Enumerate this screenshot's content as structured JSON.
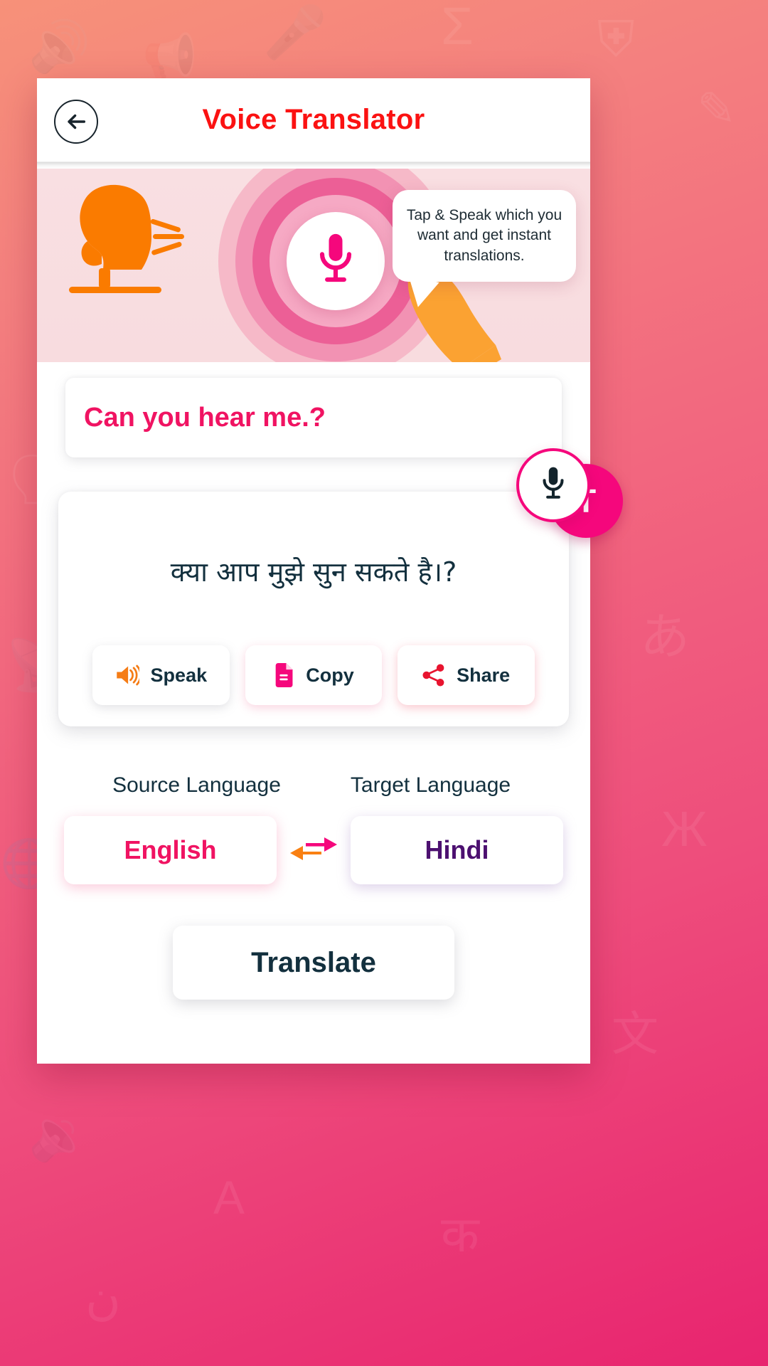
{
  "header": {
    "title": "Voice Translator",
    "back_icon": "arrow-left-icon",
    "title_color": "#fb1212"
  },
  "banner": {
    "speaker_icon": "speaking-person-icon",
    "mic_icon": "microphone-icon",
    "hand_icon": "pointing-hand-icon",
    "tooltip_text": "Tap & Speak which you want and get instant translations.",
    "ring_colors": [
      "#f6b9c8",
      "#f292b3",
      "#ec5f96",
      "#f6a9c4",
      "#ffffff"
    ],
    "mic_color": "#f5077c"
  },
  "source": {
    "text": "Can you hear me.?",
    "color": "#f01362"
  },
  "translation": {
    "text": "क्या आप मुझे सुन सकते है।?",
    "color": "#13303e",
    "actions": [
      {
        "label": "Speak",
        "icon": "speaker-volume-icon",
        "icon_color": "#f57c15"
      },
      {
        "label": "Copy",
        "icon": "document-copy-icon",
        "icon_color": "#f5077c"
      },
      {
        "label": "Share",
        "icon": "share-nodes-icon",
        "icon_color": "#e8142f"
      }
    ]
  },
  "languages": {
    "source_label": "Source Language",
    "target_label": "Target Language",
    "source_value": "English",
    "target_value": "Hindi",
    "source_color": "#f01362",
    "target_color": "#4c1070",
    "swap_icon": "swap-arrows-icon",
    "swap_left_color": "#f98012",
    "swap_right_color": "#f5077c"
  },
  "translate_button": {
    "label": "Translate"
  },
  "fab": {
    "mic_icon": "microphone-icon",
    "text_label": "T",
    "accent_color": "#f5077c"
  }
}
